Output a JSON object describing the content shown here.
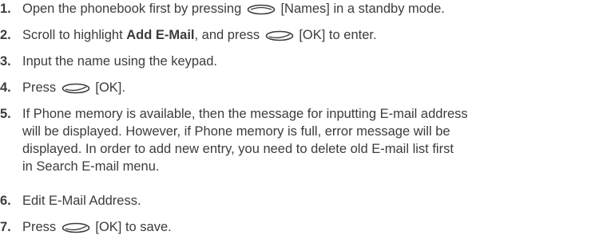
{
  "steps": [
    {
      "number": "1.",
      "text_before": "Open the phonebook first by pressing",
      "key": "soft-key-icon",
      "text_after": "[Names] in a standby mode."
    },
    {
      "number": "2.",
      "text_before": "Scroll to highlight",
      "bold": "Add E-Mail",
      "text_middle": ", and press",
      "key": "ok-key-icon",
      "text_after": "[OK] to enter."
    },
    {
      "number": "3.",
      "text": "Input the name using the keypad."
    },
    {
      "number": "4.",
      "text_before": "Press",
      "key": "ok-key-icon",
      "text_after": "[OK]."
    },
    {
      "number": "5.",
      "lines": [
        "If Phone memory is available, then the message for inputting E-mail address",
        "will be displayed. However, if Phone memory is full, error message will be",
        "displayed. In order to add new entry, you need to delete old E-mail list first",
        "in Search E-mail menu."
      ]
    },
    {
      "number": "6.",
      "text": "Edit E-Mail Address."
    },
    {
      "number": "7.",
      "text_before": "Press",
      "key": "ok-key-icon",
      "text_after": "[OK] to save."
    }
  ],
  "colors": {
    "text": "#3c3c3c"
  }
}
